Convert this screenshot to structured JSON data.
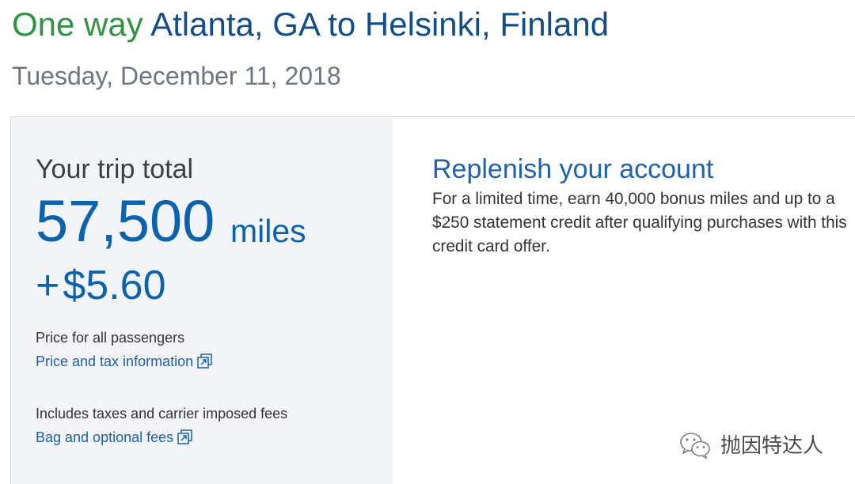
{
  "header": {
    "trip_type": "One way",
    "route": "Atlanta, GA to Helsinki, Finland",
    "date": "Tuesday, December 11, 2018"
  },
  "trip_summary": {
    "heading": "Your trip total",
    "miles_amount": "57,500",
    "miles_unit": "miles",
    "cash_prefix": "+",
    "cash_amount": "$5.60",
    "passengers_note": "Price for all passengers",
    "price_tax_link": "Price and tax information",
    "fees_note": "Includes taxes and carrier imposed fees",
    "bag_fees_link": "Bag and optional fees"
  },
  "promo": {
    "heading": "Replenish your account",
    "body_lines": [
      "For a limited time, earn 40,000 bonus miles and up to a",
      "$250 statement credit after qualifying purchases with this",
      "credit card offer."
    ]
  },
  "watermark": {
    "text": "抛因特达人"
  },
  "icons": {
    "link": "external-link-icon",
    "watermark": "wechat-icon"
  },
  "colors": {
    "trip_type_green": "#2e9440",
    "route_blue": "#134e88",
    "date_gray": "#6b7682",
    "price_blue": "#0d62ad",
    "heading_blue": "#1f62ad",
    "link_blue": "#1d5ead",
    "panel_bg": "#f3f4f7"
  }
}
